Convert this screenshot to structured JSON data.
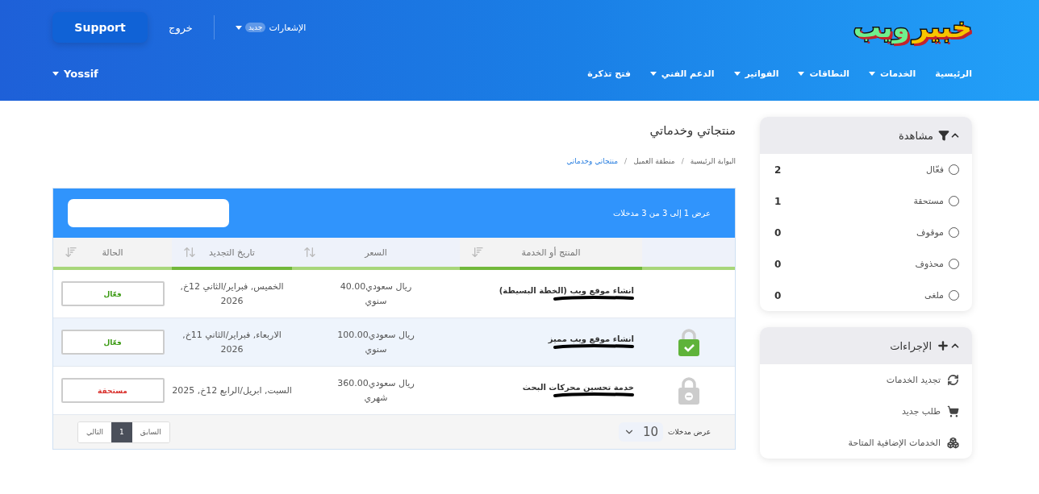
{
  "header": {
    "logo": [
      {
        "text": "خبير",
        "color": "#f7c600"
      },
      {
        "text": "ويب",
        "color": "#6ff08e"
      }
    ],
    "notifications": {
      "label": "الإشعارات",
      "badge": "جديد"
    },
    "logout": "خروج",
    "support": "Support",
    "nav": [
      {
        "label": "الرئيسية",
        "dropdown": false
      },
      {
        "label": "الخدمات",
        "dropdown": true
      },
      {
        "label": "النطاقات",
        "dropdown": true
      },
      {
        "label": "الفواتير",
        "dropdown": true
      },
      {
        "label": "الدعم الفني",
        "dropdown": true
      },
      {
        "label": "فتح تذكرة",
        "dropdown": false
      }
    ],
    "user": "Yossif"
  },
  "page": {
    "title": "منتجاتي وخدماتي",
    "breadcrumb": [
      {
        "label": "البوابة الرئيسية",
        "selected": false
      },
      {
        "separator": "/",
        "label": "منطقة العميل",
        "selected": false
      },
      {
        "separator": "/",
        "label": "منتجاتي وخدماتي",
        "selected": true
      }
    ]
  },
  "table": {
    "info": "عرض 1 إلى 3 من 3 مدخلات",
    "columns": [
      {
        "sortable": false
      },
      {
        "label": "المنتج أو الخدمة",
        "sortable": true,
        "sorted": true
      },
      {
        "label": "السعر",
        "sortable": true,
        "sorted": false
      },
      {
        "label": "تاريخ التجديد",
        "sortable": true,
        "sorted": false
      },
      {
        "label": "الحالة",
        "sortable": true,
        "sorted": true
      }
    ],
    "rows": [
      {
        "kind": "plain",
        "highlighted": false,
        "product": "انشاء موقع ويب (الخطة البسيطة)",
        "price": "ريال سعودي40.00",
        "cycle": "سنوي",
        "date": "الخميس, فبراير/الثاني 12خ, 2026",
        "status": {
          "label": "فعّال",
          "color": "#3a9a12"
        }
      },
      {
        "kind": "active",
        "highlighted": true,
        "product": "انشاء موقع ويب مميز",
        "price": "ريال سعودي100.00",
        "cycle": "سنوي",
        "date": "الاربعاء, فبراير/الثاني 11خ, 2026",
        "status": {
          "label": "فعّال",
          "color": "#3a9a12"
        }
      },
      {
        "kind": "inactive",
        "highlighted": false,
        "product": "خدمة تحسين محركات البحث",
        "price": "ريال سعودي360.00",
        "cycle": "شهري",
        "date": "السبت, ابريل/الرابع 12خ, 2025",
        "status": {
          "label": "مستحقة",
          "color": "#d9302c"
        }
      }
    ],
    "length_label": "عرض مدخلات",
    "length_value": "10",
    "pagination": [
      {
        "label": "السابق",
        "selected": false
      },
      {
        "label": "1",
        "selected": true
      },
      {
        "label": "التالي",
        "selected": false
      }
    ]
  },
  "sidebar": {
    "view": {
      "title": "مشاهدة",
      "items": [
        {
          "label": "فعّال",
          "count": "2",
          "checked": false
        },
        {
          "label": "مستحقة",
          "count": "1",
          "checked": false
        },
        {
          "label": "موقوف",
          "count": "0",
          "checked": false
        },
        {
          "label": "محذوف",
          "count": "0",
          "checked": false
        },
        {
          "label": "ملغى",
          "count": "0",
          "checked": false
        }
      ]
    },
    "actions": {
      "title": "الإجراءات",
      "items": [
        {
          "label": "تجديد الخدمات",
          "kind": "renew"
        },
        {
          "label": "طلب جديد",
          "kind": "order"
        },
        {
          "label": "الخدمات الإضافية المتاحة",
          "kind": "addons"
        }
      ]
    }
  }
}
